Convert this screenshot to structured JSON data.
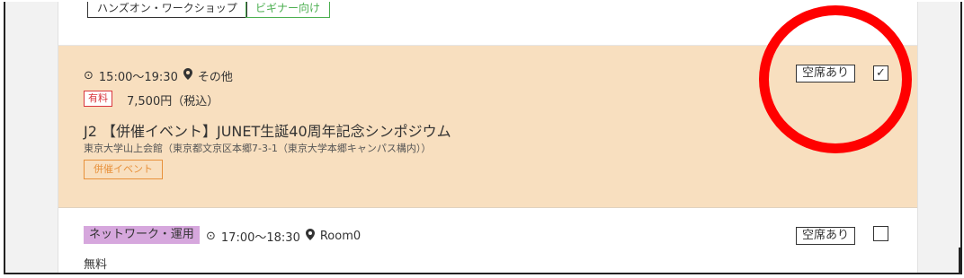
{
  "top_row": {
    "tags": [
      "ハンズオン・ワークショップ",
      "ビギナー向け"
    ]
  },
  "event_highlight": {
    "time": "15:00〜19:30",
    "place": "その他",
    "price_badge": "有料",
    "price": "7,500円（税込）",
    "title": "J2 【併催イベント】JUNET生誕40周年記念シンポジウム",
    "venue": "東京大学山上会館（東京都文京区本郷7-3-1（東京大学本郷キャンパス構内））",
    "tag": "併催イベント",
    "status": "空席あり",
    "checked_mark": "✓"
  },
  "event_next": {
    "category": "ネットワーク・運用",
    "time": "17:00〜18:30",
    "place": "Room0",
    "price": "無料",
    "status": "空席あり"
  },
  "icons": {
    "clock": "⊙",
    "pin": "📍"
  },
  "colors": {
    "highlight_bg": "#f8dfbf",
    "annotation_circle": "#ff0000",
    "paid_badge": "#d9363e",
    "kyosai_tag": "#e8913b",
    "beginner_tag": "#4caf50",
    "category_tag": "#d6a7dd"
  }
}
